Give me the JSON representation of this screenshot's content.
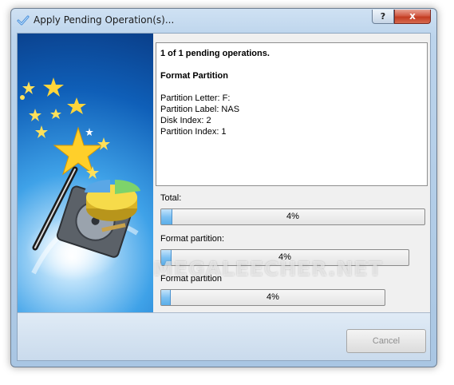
{
  "window": {
    "title": "Apply Pending Operation(s)..."
  },
  "titlebar_buttons": {
    "help": "?",
    "close": "x"
  },
  "details": {
    "summary": "1 of 1 pending operations.",
    "operation": "Format Partition",
    "properties": [
      "Partition Letter: F:",
      "Partition Label: NAS",
      "Disk Index: 2",
      "Partition Index: 1"
    ]
  },
  "progress": [
    {
      "label": "Total:",
      "value": 0.04,
      "text": "4%"
    },
    {
      "label": "Format partition:",
      "value": 0.04,
      "text": "4%"
    },
    {
      "label": "Format partition",
      "value": 0.04,
      "text": "4%"
    }
  ],
  "watermark": "MEGALEECHER.NET",
  "footer": {
    "cancel_label": "Cancel"
  },
  "icons": {
    "title": "checkmark-icon",
    "art": "magic-wand-disk-icon"
  },
  "colors": {
    "progress_fill": "#6db8ef",
    "close_button": "#c9432b"
  }
}
